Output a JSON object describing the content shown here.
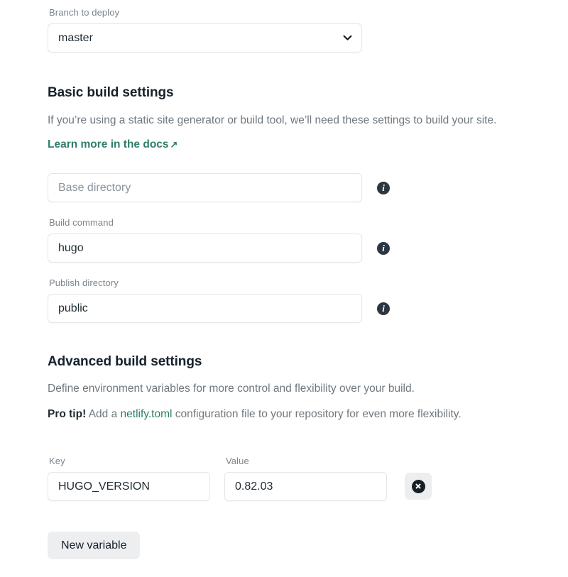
{
  "branch": {
    "label": "Branch to deploy",
    "selected": "master",
    "chevron_icon": "chevron-down-icon"
  },
  "basic": {
    "title": "Basic build settings",
    "description": "If you’re using a static site generator or build tool, we’ll need these settings to build your site.",
    "docs_link": "Learn more in the docs",
    "docs_arrow": "↗",
    "fields": [
      {
        "label": "",
        "placeholder": "Base directory",
        "value": "",
        "info_icon": "info-icon"
      },
      {
        "label": "Build command",
        "placeholder": "",
        "value": "hugo",
        "info_icon": "info-icon"
      },
      {
        "label": "Publish directory",
        "placeholder": "",
        "value": "public",
        "info_icon": "info-icon"
      }
    ]
  },
  "advanced": {
    "title": "Advanced build settings",
    "description": "Define environment variables for more control and flexibility over your build.",
    "pro_tip_lead": "Pro tip!",
    "pro_tip_before": " Add a ",
    "pro_tip_link": "netlify.toml",
    "pro_tip_after": " configuration file to your repository for even more flexibility.",
    "key_label": "Key",
    "value_label": "Value",
    "variables": [
      {
        "key": "HUGO_VERSION",
        "value": "0.82.03",
        "remove_icon": "remove-circle-icon"
      }
    ],
    "new_variable_label": "New variable"
  },
  "colors": {
    "accent_green": "#2f7d6b",
    "text_dark": "#1f2b33",
    "text_muted": "#6f787f",
    "label_gray": "#7a858e",
    "border": "#e3e6e8",
    "button_bg": "#eceef0"
  }
}
